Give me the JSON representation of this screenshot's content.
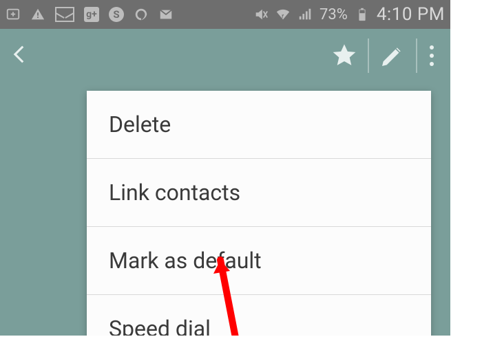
{
  "status_bar": {
    "battery_percent": "73%",
    "clock": "4:10 PM",
    "icons": {
      "new_tab": "new-tab-icon",
      "warning": "warning-icon",
      "mail": "mail-unread-icon",
      "gplus": "g+",
      "skype": "S",
      "hangouts": "hangouts-icon",
      "gmail": "M",
      "mute": "mute-icon",
      "wifi": "wifi-icon",
      "signal": "signal-icon",
      "battery": "battery-icon"
    }
  },
  "action_bar": {
    "back": "back-icon",
    "star": "favorite-icon",
    "edit": "edit-icon",
    "overflow": "overflow-icon"
  },
  "menu": {
    "items": [
      {
        "label": "Delete"
      },
      {
        "label": "Link contacts"
      },
      {
        "label": "Mark as default"
      },
      {
        "label": "Speed dial"
      }
    ]
  },
  "annotation": {
    "arrow_color": "#ff0000"
  }
}
